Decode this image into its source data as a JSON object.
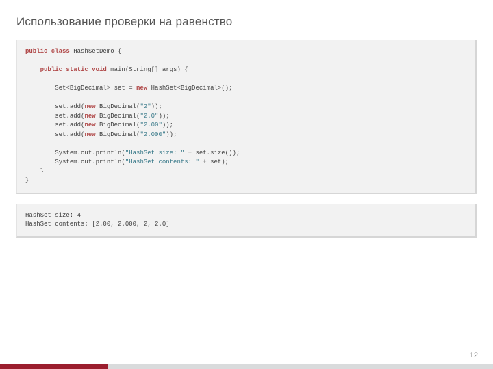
{
  "title": "Использование проверки на равенство",
  "page_number": "12",
  "colors": {
    "accent_red": "#9b1e2e",
    "footer_gray": "#d9dbdc",
    "code_bg": "#f2f2f2"
  },
  "code": {
    "line1": {
      "kw1": "public class",
      "rest": " HashSetDemo {"
    },
    "line2": {
      "indent": "    ",
      "kw1": "public static void",
      "rest": " main(String[] args) {"
    },
    "line3": {
      "indent": "        ",
      "t1": "Set<BigDecimal> set = ",
      "kw1": "new",
      "t2": " HashSet<BigDecimal>();"
    },
    "line4": {
      "indent": "        ",
      "t1": "set.add(",
      "kw1": "new",
      "t2": " BigDecimal(",
      "s": "\"2\"",
      "t3": "));"
    },
    "line5": {
      "indent": "        ",
      "t1": "set.add(",
      "kw1": "new",
      "t2": " BigDecimal(",
      "s": "\"2.0\"",
      "t3": "));"
    },
    "line6": {
      "indent": "        ",
      "t1": "set.add(",
      "kw1": "new",
      "t2": " BigDecimal(",
      "s": "\"2.00\"",
      "t3": "));"
    },
    "line7": {
      "indent": "        ",
      "t1": "set.add(",
      "kw1": "new",
      "t2": " BigDecimal(",
      "s": "\"2.000\"",
      "t3": "));"
    },
    "line8": {
      "indent": "        ",
      "t1": "System.out.println(",
      "s": "\"HashSet size: \"",
      "t2": " + set.size());"
    },
    "line9": {
      "indent": "        ",
      "t1": "System.out.println(",
      "s": "\"HashSet contents: \"",
      "t2": " + set);"
    },
    "line10": "    }",
    "line11": "}"
  },
  "output": {
    "line1": "HashSet size: 4",
    "line2": "HashSet contents: [2.00, 2.000, 2, 2.0]"
  }
}
